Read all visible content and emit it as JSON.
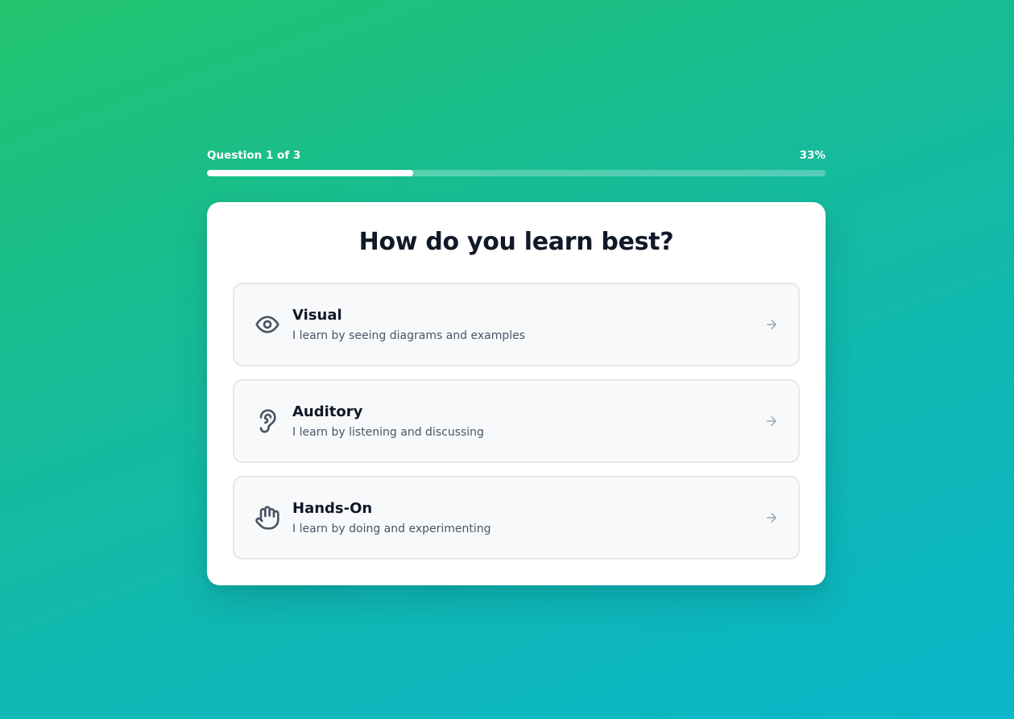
{
  "progress": {
    "label": "Question 1 of 3",
    "percent_label": "33%",
    "fraction": 0.333
  },
  "question": {
    "title": "How do you learn best?"
  },
  "options": [
    {
      "icon": "eye-icon",
      "title": "Visual",
      "description": "I learn by seeing diagrams and examples"
    },
    {
      "icon": "ear-icon",
      "title": "Auditory",
      "description": "I learn by listening and discussing"
    },
    {
      "icon": "hand-icon",
      "title": "Hands-On",
      "description": "I learn by doing and experimenting"
    }
  ],
  "colors": {
    "gradient_start": "#22c46e",
    "gradient_end": "#0ab6c9",
    "card_bg": "#ffffff",
    "option_bg": "#f8f9fb",
    "option_border": "#e5e7eb",
    "title_text": "#111827",
    "muted_text": "#4b5563"
  }
}
